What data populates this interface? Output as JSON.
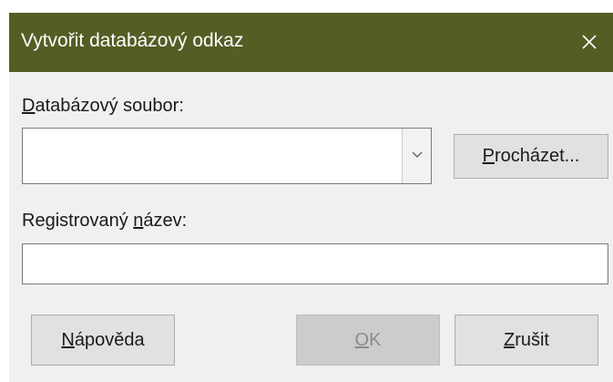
{
  "dialog": {
    "title": "Vytvořit databázový odkaz",
    "close_icon": "close-icon"
  },
  "database_file": {
    "label_mnemonic": "D",
    "label_rest": "atabázový soubor:",
    "value": "",
    "dropdown_icon": "chevron-down-icon"
  },
  "browse_button": {
    "mnemonic": "P",
    "rest": "rocházet..."
  },
  "registered_name": {
    "label_before": "Registrovaný ",
    "label_mnemonic": "n",
    "label_after": "ázev:",
    "value": ""
  },
  "buttons": {
    "help_mnemonic": "N",
    "help_rest": "ápověda",
    "ok_mnemonic": "O",
    "ok_rest": "K",
    "ok_enabled": false,
    "cancel_mnemonic": "Z",
    "cancel_rest": "rušit"
  },
  "colors": {
    "titlebar": "#555d25",
    "dialog_bg": "#f0f0f0"
  }
}
